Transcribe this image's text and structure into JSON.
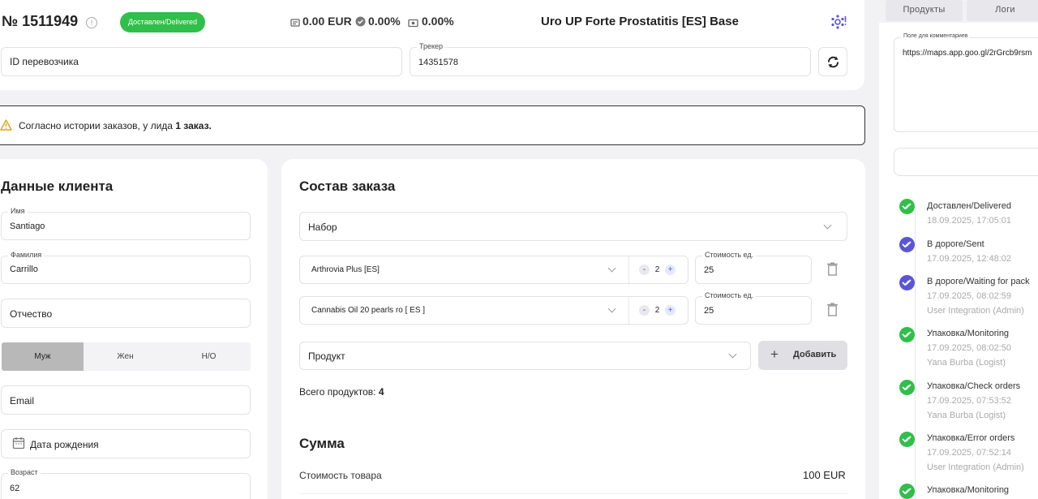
{
  "order": {
    "number": "№ 1511949",
    "status_badge": "Доставлен/Delivered",
    "amount": "0.00 EUR",
    "percent1": "0.00%",
    "percent2": "0.00%",
    "product_title": "Uro UP Forte Prostatitis [ES] Base"
  },
  "carrier": {
    "id_placeholder": "ID перевозчика",
    "tracker_label": "Трекер",
    "tracker_value": "14351578"
  },
  "alert": {
    "text": "Согласно истории заказов, у лида ",
    "bold": "1 заказ."
  },
  "client": {
    "title": "Данные клиента",
    "first_name_label": "Имя",
    "first_name": "Santiago",
    "last_name_label": "Фамилия",
    "last_name": "Carrillo",
    "patronymic_placeholder": "Отчество",
    "gender_options": [
      "Муж",
      "Жен",
      "Н/О"
    ],
    "gender_selected": "Муж",
    "email_placeholder": "Email",
    "birthdate_placeholder": "Дата рождения",
    "age_label": "Возраст",
    "age": "62"
  },
  "order_items": {
    "title": "Состав заказа",
    "set_placeholder": "Набор",
    "items": [
      {
        "name": "Arthrovia Plus [ES]",
        "qty": "2",
        "price_label": "Стоимость ед.",
        "price": "25"
      },
      {
        "name": "Cannabis Oil 20 pearls ro [ ES ]",
        "qty": "2",
        "price_label": "Стоимость ед.",
        "price": "25"
      }
    ],
    "product_placeholder": "Продукт",
    "add_button": "Добавить",
    "total_label": "Всего продуктов: ",
    "total_value": "4"
  },
  "sum": {
    "title": "Сумма",
    "goods_cost_label": "Стоимость товара",
    "goods_cost_value": "100 EUR"
  },
  "sidebar": {
    "tabs": [
      "Продукты",
      "Логи"
    ],
    "comment_label": "Поле для комментариев",
    "comment_value": "https://maps.app.goo.gl/2rGrcb9rsm",
    "timeline": [
      {
        "status": "Доставлен/Delivered",
        "date": "18.09.2025, 17:05:01",
        "user": "",
        "color": "green"
      },
      {
        "status": "В дороге/Sent",
        "date": "17.09.2025, 12:48:02",
        "user": "",
        "color": "blue"
      },
      {
        "status": "В дороге/Waiting for pack",
        "date": "17.09.2025, 08:02:59",
        "user": "User Integration (Admin)",
        "color": "blue"
      },
      {
        "status": "Упаковка/Monitoring",
        "date": "17.09.2025, 08:02:50",
        "user": "Yana Burba (Logist)",
        "color": "green"
      },
      {
        "status": "Упаковка/Check orders",
        "date": "17.09.2025, 07:53:52",
        "user": "Yana Burba (Logist)",
        "color": "green"
      },
      {
        "status": "Упаковка/Error orders",
        "date": "17.09.2025, 07:52:14",
        "user": "User Integration (Admin)",
        "color": "green"
      },
      {
        "status": "Упаковка/Monitoring",
        "date": "",
        "user": "",
        "color": "green"
      }
    ]
  },
  "colors": {
    "accent": "#5a55d8",
    "status_green": "#2fbf4a",
    "alert_icon": "#e0a21b"
  }
}
